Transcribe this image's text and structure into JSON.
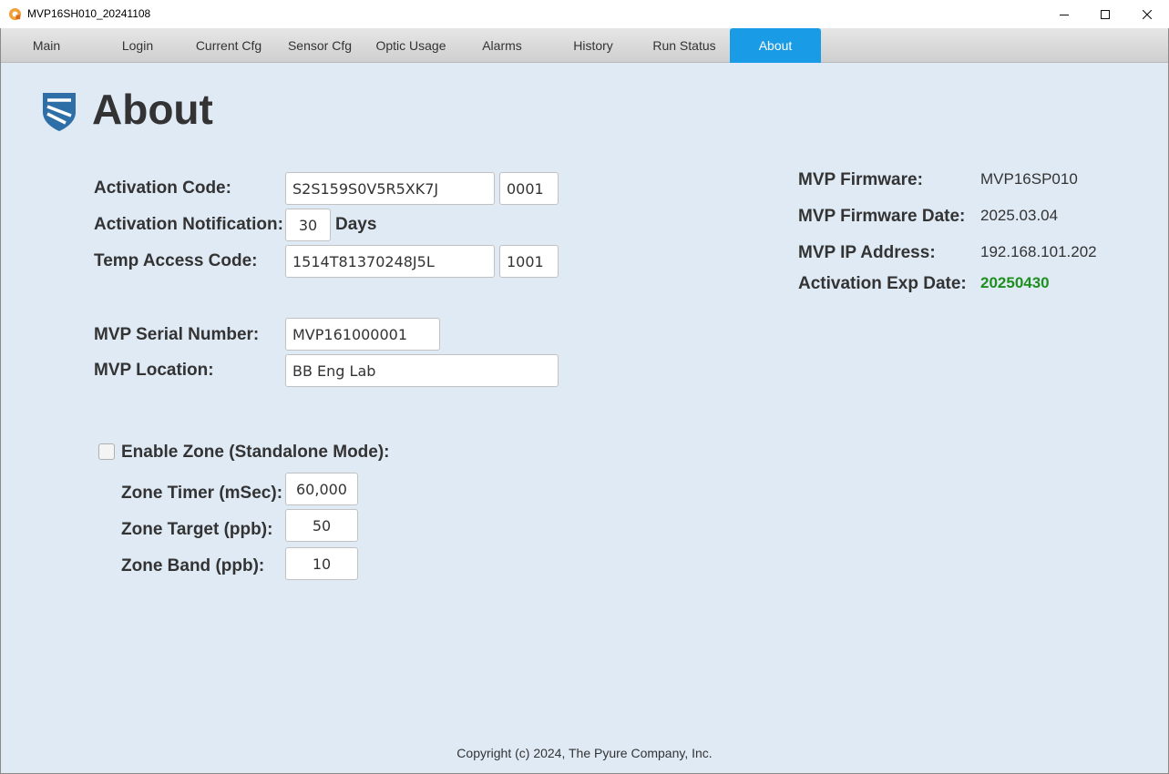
{
  "window": {
    "title": "MVP16SH010_20241108",
    "controls": {
      "minimize": "minimize-icon",
      "maximize": "maximize-icon",
      "close": "close-icon"
    }
  },
  "tabs": [
    {
      "label": "Main"
    },
    {
      "label": "Login"
    },
    {
      "label": "Current Cfg"
    },
    {
      "label": "Sensor Cfg"
    },
    {
      "label": "Optic Usage"
    },
    {
      "label": "Alarms"
    },
    {
      "label": "History"
    },
    {
      "label": "Run Status"
    },
    {
      "label": "About",
      "active": true
    }
  ],
  "colors": {
    "active_tab": "#1a9be6",
    "background": "#dfeaf5",
    "exp_date": "#1e8f1e",
    "logo": "#2e6fa8"
  },
  "page": {
    "title": "About"
  },
  "form": {
    "activation_code": {
      "label": "Activation Code:",
      "value": "S2S159S0V5R5XK7J",
      "suffix": "0001"
    },
    "activation_notification": {
      "label": "Activation Notification:",
      "value": "30",
      "unit": "Days"
    },
    "temp_access_code": {
      "label": "Temp Access Code:",
      "value": "1514T81370248J5L",
      "suffix": "1001"
    },
    "serial_number": {
      "label": "MVP Serial Number:",
      "value": "MVP161000001"
    },
    "location": {
      "label": "MVP Location:",
      "value": "BB Eng Lab"
    }
  },
  "zone": {
    "enable_label": "Enable Zone (Standalone Mode):",
    "enabled": false,
    "timer": {
      "label": "Zone Timer (mSec):",
      "value": "60,000"
    },
    "target": {
      "label": "Zone Target (ppb):",
      "value": "50"
    },
    "band": {
      "label": "Zone Band (ppb):",
      "value": "10"
    }
  },
  "info": {
    "firmware": {
      "label": "MVP Firmware:",
      "value": "MVP16SP010"
    },
    "firmware_date": {
      "label": "MVP Firmware Date:",
      "value": "2025.03.04"
    },
    "ip_address": {
      "label": "MVP IP Address:",
      "value": "192.168.101.202"
    },
    "activation_exp": {
      "label": "Activation Exp Date:",
      "value": "20250430"
    }
  },
  "footer": {
    "copyright": "Copyright (c) 2024, The Pyure Company, Inc."
  }
}
